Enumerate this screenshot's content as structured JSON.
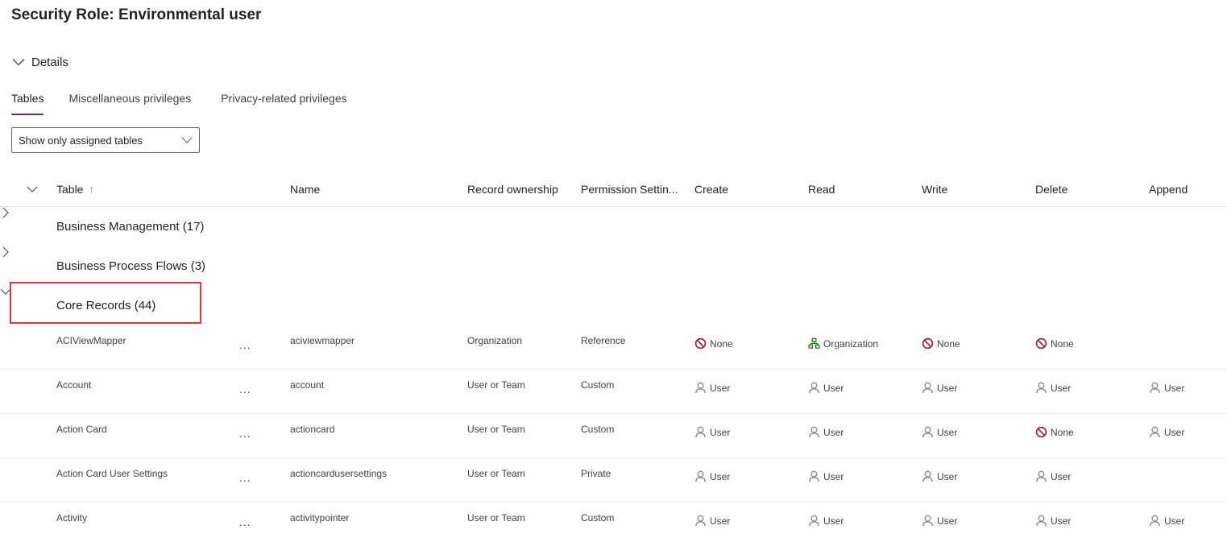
{
  "page": {
    "title": "Security Role: Environmental user"
  },
  "details": {
    "label": "Details",
    "expanded": true
  },
  "tabs": [
    {
      "label": "Tables",
      "active": true
    },
    {
      "label": "Miscellaneous privileges",
      "active": false
    },
    {
      "label": "Privacy-related privileges",
      "active": false
    }
  ],
  "filter": {
    "selected": "Show only assigned tables"
  },
  "colors": {
    "accent": "#742774",
    "none_icon": "#a4262c",
    "org_icon": "#107c10",
    "user_icon": "#8a8886",
    "highlight_border": "#e0373d"
  },
  "grid": {
    "headers": {
      "table": "Table",
      "table_sort": "↑",
      "name": "Name",
      "record_ownership": "Record ownership",
      "permission_settings": "Permission Settin...",
      "create": "Create",
      "read": "Read",
      "write": "Write",
      "delete": "Delete",
      "append": "Append"
    },
    "groups": [
      {
        "label": "Business Management (17)",
        "expanded": false
      },
      {
        "label": "Business Process Flows (3)",
        "expanded": false
      },
      {
        "label": "Core Records (44)",
        "expanded": true,
        "highlighted": true
      }
    ],
    "more_label": "...",
    "rows": [
      {
        "table": "ACIViewMapper",
        "name": "aciviewmapper",
        "ownership": "Organization",
        "permission": "Reference",
        "create": {
          "icon": "none-icon",
          "label": "None"
        },
        "read": {
          "icon": "organization-icon",
          "label": "Organization"
        },
        "write": {
          "icon": "none-icon",
          "label": "None"
        },
        "delete": {
          "icon": "none-icon",
          "label": "None"
        },
        "append": null
      },
      {
        "table": "Account",
        "name": "account",
        "ownership": "User or Team",
        "permission": "Custom",
        "create": {
          "icon": "user-icon",
          "label": "User"
        },
        "read": {
          "icon": "user-icon",
          "label": "User"
        },
        "write": {
          "icon": "user-icon",
          "label": "User"
        },
        "delete": {
          "icon": "user-icon",
          "label": "User"
        },
        "append": {
          "icon": "user-icon",
          "label": "User"
        }
      },
      {
        "table": "Action Card",
        "name": "actioncard",
        "ownership": "User or Team",
        "permission": "Custom",
        "create": {
          "icon": "user-icon",
          "label": "User"
        },
        "read": {
          "icon": "user-icon",
          "label": "User"
        },
        "write": {
          "icon": "user-icon",
          "label": "User"
        },
        "delete": {
          "icon": "none-icon",
          "label": "None"
        },
        "append": {
          "icon": "user-icon",
          "label": "User"
        }
      },
      {
        "table": "Action Card User Settings",
        "name": "actioncardusersettings",
        "ownership": "User or Team",
        "permission": "Private",
        "create": {
          "icon": "user-icon",
          "label": "User"
        },
        "read": {
          "icon": "user-icon",
          "label": "User"
        },
        "write": {
          "icon": "user-icon",
          "label": "User"
        },
        "delete": {
          "icon": "user-icon",
          "label": "User"
        },
        "append": null
      },
      {
        "table": "Activity",
        "name": "activitypointer",
        "ownership": "User or Team",
        "permission": "Custom",
        "create": {
          "icon": "user-icon",
          "label": "User"
        },
        "read": {
          "icon": "user-icon",
          "label": "User"
        },
        "write": {
          "icon": "user-icon",
          "label": "User"
        },
        "delete": {
          "icon": "user-icon",
          "label": "User"
        },
        "append": {
          "icon": "user-icon",
          "label": "User"
        }
      }
    ]
  }
}
